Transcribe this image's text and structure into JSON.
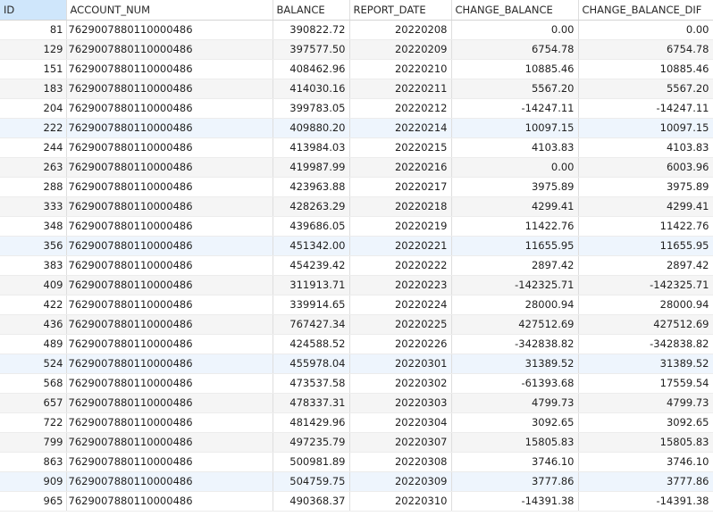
{
  "columns": [
    "ID",
    "ACCOUNT_NUM",
    "BALANCE",
    "REPORT_DATE",
    "CHANGE_BALANCE",
    "CHANGE_BALANCE_DIF"
  ],
  "rows": [
    [
      "81",
      "7629007880110000486",
      "390822.72",
      "20220208",
      "0.00",
      "0.00"
    ],
    [
      "129",
      "7629007880110000486",
      "397577.50",
      "20220209",
      "6754.78",
      "6754.78"
    ],
    [
      "151",
      "7629007880110000486",
      "408462.96",
      "20220210",
      "10885.46",
      "10885.46"
    ],
    [
      "183",
      "7629007880110000486",
      "414030.16",
      "20220211",
      "5567.20",
      "5567.20"
    ],
    [
      "204",
      "7629007880110000486",
      "399783.05",
      "20220212",
      "-14247.11",
      "-14247.11"
    ],
    [
      "222",
      "7629007880110000486",
      "409880.20",
      "20220214",
      "10097.15",
      "10097.15"
    ],
    [
      "244",
      "7629007880110000486",
      "413984.03",
      "20220215",
      "4103.83",
      "4103.83"
    ],
    [
      "263",
      "7629007880110000486",
      "419987.99",
      "20220216",
      "0.00",
      "6003.96"
    ],
    [
      "288",
      "7629007880110000486",
      "423963.88",
      "20220217",
      "3975.89",
      "3975.89"
    ],
    [
      "333",
      "7629007880110000486",
      "428263.29",
      "20220218",
      "4299.41",
      "4299.41"
    ],
    [
      "348",
      "7629007880110000486",
      "439686.05",
      "20220219",
      "11422.76",
      "11422.76"
    ],
    [
      "356",
      "7629007880110000486",
      "451342.00",
      "20220221",
      "11655.95",
      "11655.95"
    ],
    [
      "383",
      "7629007880110000486",
      "454239.42",
      "20220222",
      "2897.42",
      "2897.42"
    ],
    [
      "409",
      "7629007880110000486",
      "311913.71",
      "20220223",
      "-142325.71",
      "-142325.71"
    ],
    [
      "422",
      "7629007880110000486",
      "339914.65",
      "20220224",
      "28000.94",
      "28000.94"
    ],
    [
      "436",
      "7629007880110000486",
      "767427.34",
      "20220225",
      "427512.69",
      "427512.69"
    ],
    [
      "489",
      "7629007880110000486",
      "424588.52",
      "20220226",
      "-342838.82",
      "-342838.82"
    ],
    [
      "524",
      "7629007880110000486",
      "455978.04",
      "20220301",
      "31389.52",
      "31389.52"
    ],
    [
      "568",
      "7629007880110000486",
      "473537.58",
      "20220302",
      "-61393.68",
      "17559.54"
    ],
    [
      "657",
      "7629007880110000486",
      "478337.31",
      "20220303",
      "4799.73",
      "4799.73"
    ],
    [
      "722",
      "7629007880110000486",
      "481429.96",
      "20220304",
      "3092.65",
      "3092.65"
    ],
    [
      "799",
      "7629007880110000486",
      "497235.79",
      "20220307",
      "15805.83",
      "15805.83"
    ],
    [
      "863",
      "7629007880110000486",
      "500981.89",
      "20220308",
      "3746.10",
      "3746.10"
    ],
    [
      "909",
      "7629007880110000486",
      "504759.75",
      "20220309",
      "3777.86",
      "3777.86"
    ],
    [
      "965",
      "7629007880110000486",
      "490368.37",
      "20220310",
      "-14391.38",
      "-14391.38"
    ]
  ],
  "highlighted_rows": [
    5,
    11,
    17,
    23
  ],
  "colors": {
    "header_selected_bg": "#cfe6fb",
    "row_alt_bg": "#f5f5f5",
    "row_highlight_bg": "#eef5fd",
    "grid_line": "#dedede"
  }
}
